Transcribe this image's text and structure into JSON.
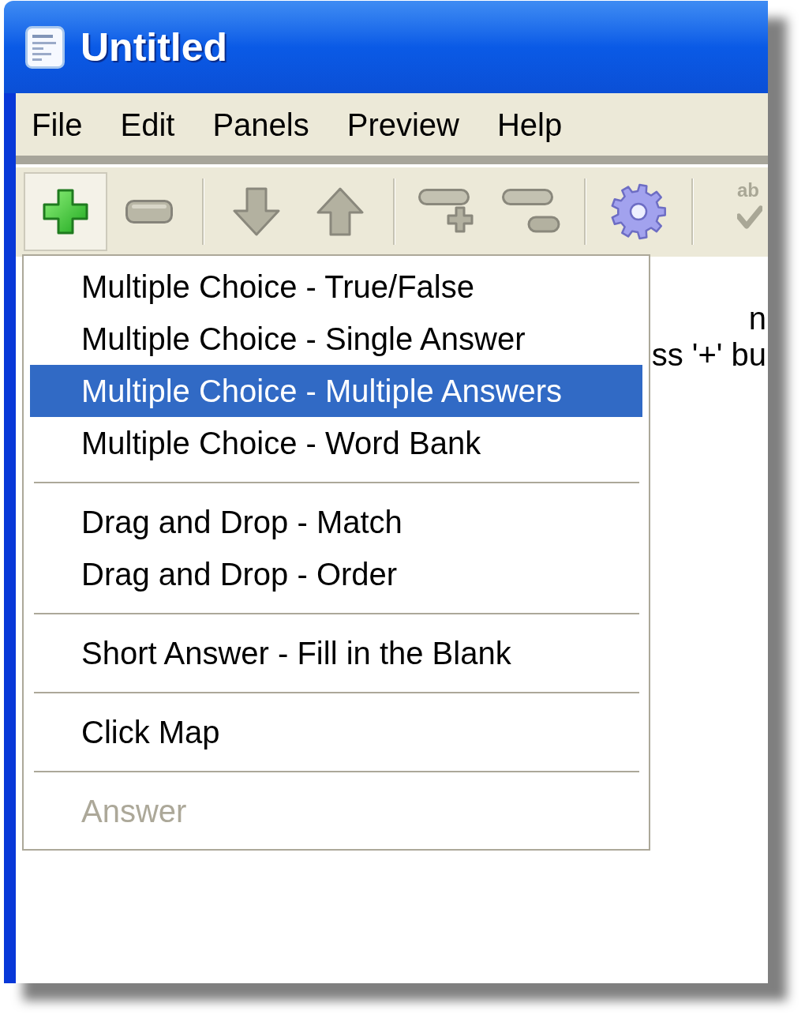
{
  "window": {
    "title": "Untitled"
  },
  "menu_bar": [
    {
      "label": "File"
    },
    {
      "label": "Edit"
    },
    {
      "label": "Panels"
    },
    {
      "label": "Preview"
    },
    {
      "label": "Help"
    }
  ],
  "toolbar": [
    {
      "kind": "add",
      "pressed": true
    },
    {
      "kind": "remove",
      "pressed": false
    },
    {
      "kind": "separator"
    },
    {
      "kind": "move_down",
      "pressed": false
    },
    {
      "kind": "move_up",
      "pressed": false
    },
    {
      "kind": "separator"
    },
    {
      "kind": "add_row",
      "pressed": false
    },
    {
      "kind": "remove_row",
      "pressed": false
    },
    {
      "kind": "separator"
    },
    {
      "kind": "settings",
      "pressed": false
    },
    {
      "kind": "separator"
    },
    {
      "kind": "spellcheck",
      "pressed": false,
      "label": "ab"
    }
  ],
  "content": {
    "lines": [
      "n",
      "ss '+' bu"
    ]
  },
  "add_menu": {
    "items": [
      {
        "kind": "item",
        "label": "Multiple Choice - True/False",
        "selected": false,
        "disabled": false
      },
      {
        "kind": "item",
        "label": "Multiple Choice - Single Answer",
        "selected": false,
        "disabled": false
      },
      {
        "kind": "item",
        "label": "Multiple Choice - Multiple Answers",
        "selected": true,
        "disabled": false
      },
      {
        "kind": "item",
        "label": "Multiple Choice - Word Bank",
        "selected": false,
        "disabled": false
      },
      {
        "kind": "separator"
      },
      {
        "kind": "item",
        "label": "Drag and Drop - Match",
        "selected": false,
        "disabled": false
      },
      {
        "kind": "item",
        "label": "Drag and Drop - Order",
        "selected": false,
        "disabled": false
      },
      {
        "kind": "separator"
      },
      {
        "kind": "item",
        "label": "Short Answer - Fill in the Blank",
        "selected": false,
        "disabled": false
      },
      {
        "kind": "separator"
      },
      {
        "kind": "item",
        "label": "Click Map",
        "selected": false,
        "disabled": false
      },
      {
        "kind": "separator"
      },
      {
        "kind": "item",
        "label": "Answer",
        "selected": false,
        "disabled": true
      }
    ]
  }
}
